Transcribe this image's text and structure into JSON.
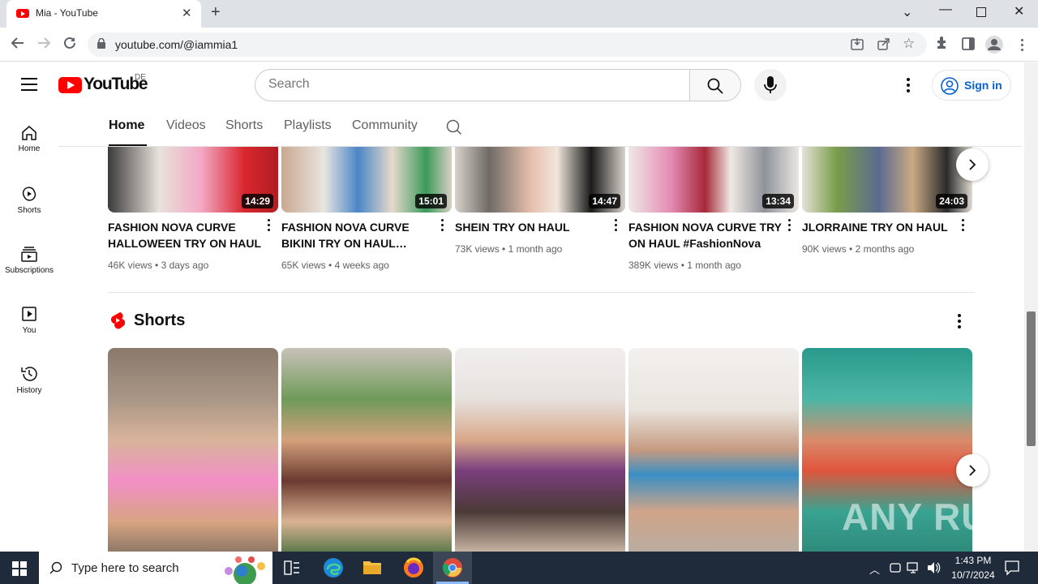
{
  "browser": {
    "tab_title": "Mia - YouTube",
    "url": "youtube.com/@iammia1"
  },
  "youtube": {
    "logo_text": "YouTube",
    "country_code": "DE",
    "search_placeholder": "Search",
    "signin_label": "Sign in"
  },
  "sidebar": {
    "items": [
      {
        "label": "Home",
        "icon": "home-icon"
      },
      {
        "label": "Shorts",
        "icon": "shorts-icon"
      },
      {
        "label": "Subscriptions",
        "icon": "subscriptions-icon"
      },
      {
        "label": "You",
        "icon": "you-icon"
      },
      {
        "label": "History",
        "icon": "history-icon"
      }
    ]
  },
  "channel_tabs": [
    "Home",
    "Videos",
    "Shorts",
    "Playlists",
    "Community"
  ],
  "videos": [
    {
      "title_line1": "FASHION NOVA CURVE",
      "title_line2": "HALLOWEEN TRY ON HAUL",
      "duration": "14:29",
      "views": "46K views",
      "age": "3 days ago"
    },
    {
      "title_line1": "FASHION NOVA CURVE",
      "title_line2": "BIKINI TRY ON HAUL…",
      "duration": "15:01",
      "views": "65K views",
      "age": "4 weeks ago"
    },
    {
      "title_line1": "SHEIN TRY ON HAUL",
      "title_line2": "",
      "duration": "14:47",
      "views": "73K views",
      "age": "1 month ago"
    },
    {
      "title_line1": "FASHION NOVA CURVE TRY",
      "title_line2": "ON HAUL #FashionNova",
      "duration": "13:34",
      "views": "389K views",
      "age": "1 month ago"
    },
    {
      "title_line1": "JLORRAINE TRY ON HAUL",
      "title_line2": "",
      "duration": "24:03",
      "views": "90K views",
      "age": "2 months ago"
    }
  ],
  "shorts_section": {
    "title": "Shorts"
  },
  "watermark": "ANY RUN",
  "taskbar": {
    "search_placeholder": "Type here to search",
    "time": "1:43 PM",
    "date": "10/7/2024"
  },
  "colors": {
    "brand_red": "#ff0000",
    "link_blue": "#065fd4",
    "taskbar": "#1f2b3b"
  }
}
